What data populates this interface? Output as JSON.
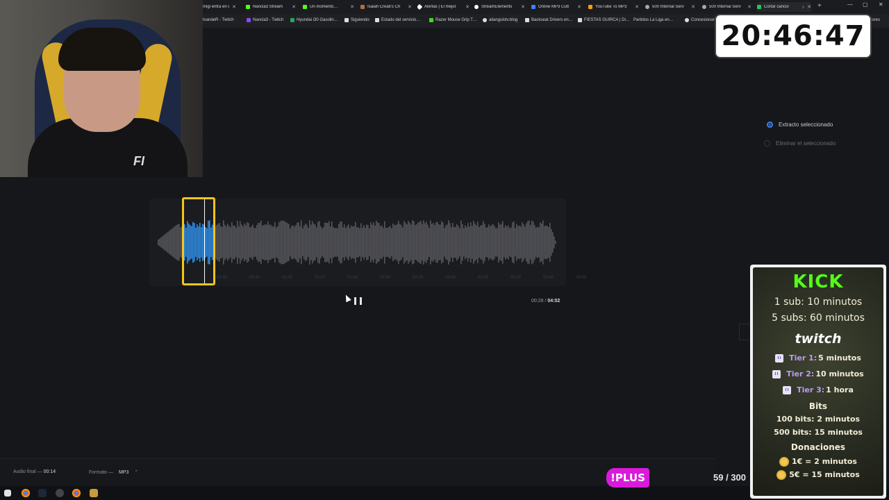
{
  "browser": {
    "tabs": [
      {
        "label": "migi entra en el",
        "color": "#777777"
      },
      {
        "label": "Nancla3 Stream",
        "color": "#53fc18"
      },
      {
        "label": "Un momento…",
        "color": "#53fc18"
      },
      {
        "label": "Isaiah Creati's Ch",
        "color": "#b07040"
      },
      {
        "label": "Alertas | El mejor",
        "color": "#ffffff"
      },
      {
        "label": "StreamElements",
        "color": "#ffffff"
      },
      {
        "label": "Online MP3 Cutt",
        "color": "#3b82f6"
      },
      {
        "label": "YouTube To MP3",
        "color": "#f59e0b"
      },
      {
        "label": "500 Internal Serv",
        "color": "#aaaaaa"
      },
      {
        "label": "500 Internal Serv",
        "color": "#aaaaaa"
      },
      {
        "label": "Cortar cancio",
        "color": "#22c55e"
      }
    ],
    "bookmarks": [
      {
        "label": "tvandeR - Twitch",
        "color": "#9146ff"
      },
      {
        "label": "Nancla3 - Twitch",
        "color": "#9146ff"
      },
      {
        "label": "Hyundai i30 Gasolin…",
        "color": "#22aa55"
      },
      {
        "label": "Siguiendo",
        "color": "#dddddd"
      },
      {
        "label": "Estado del servicio…",
        "color": "#dddddd"
      },
      {
        "label": "Razer Mouse Grip T…",
        "color": "#44d62c"
      },
      {
        "label": "aliangulotv.blog",
        "color": "#dddddd"
      },
      {
        "label": "Backseat Drivers en…",
        "color": "#dddddd"
      },
      {
        "label": "FIESTAS GUIRCA | Di…",
        "color": "#dddddd"
      },
      {
        "label": "Partidos La Liga en…",
        "color": "#dddddd"
      },
      {
        "label": "Concesionario",
        "color": "#dddddd"
      },
      {
        "label": "dores",
        "color": "#dddddd"
      }
    ]
  },
  "clock": {
    "time": "20:46:47"
  },
  "options": {
    "selected": "Extracto seleccionado",
    "remove": "Eliminar el seleccionado"
  },
  "player": {
    "current": "00:28",
    "separator": "/",
    "total": "04:02",
    "ticks": [
      "00:20",
      "00:40",
      "01:00",
      "01:20",
      "01:40",
      "02:00",
      "02:20",
      "02:40",
      "03:00",
      "03:20",
      "03:40",
      "04:00"
    ]
  },
  "export": {
    "final_label": "Audio final —",
    "final_value": "00:14",
    "format_label": "Formato —",
    "format_value": "MP3"
  },
  "overlay": {
    "plus_label": "!PLUS",
    "counter": "59 / 300",
    "kick_title": "KICK",
    "kick_line1": "1 sub: 10 minutos",
    "kick_line2": "5 subs: 60 minutos",
    "twitch_title": "twitch",
    "tier1_label": "Tier 1:",
    "tier1_value": "5 minutos",
    "tier2_label": "Tier 2:",
    "tier2_value": "10 minutos",
    "tier3_label": "Tier 3:",
    "tier3_value": "1 hora",
    "bits_title": "Bits",
    "bits_line1": "100 bits: 2 minutos",
    "bits_line2": "500 bits: 15 minutos",
    "donations_title": "Donaciones",
    "don_line1": "1€ = 2 minutos",
    "don_line2": "5€ = 15 minutos"
  },
  "colors": {
    "accent": "#3b82f6",
    "selection": "#f5c518",
    "kick": "#53fc18",
    "plus": "#d91bd9"
  }
}
